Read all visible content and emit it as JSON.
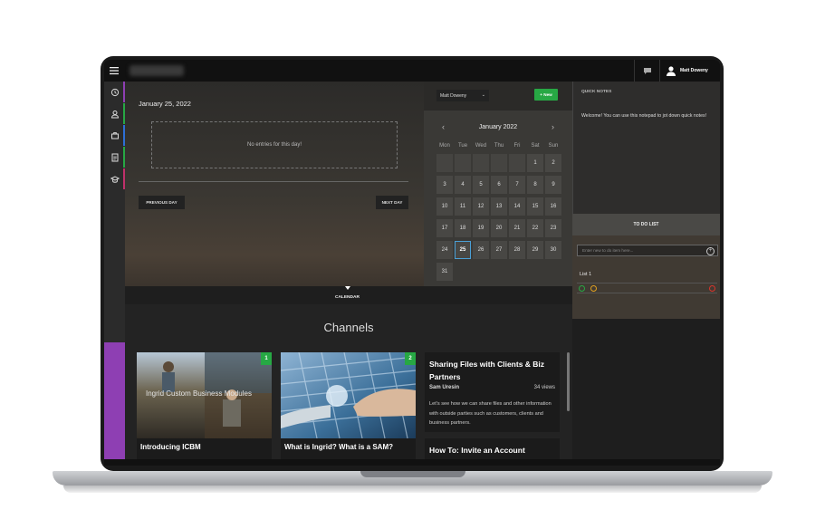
{
  "topbar": {
    "user_name": "Matt Doweny",
    "icons": [
      "hamburger-icon",
      "chat-icon",
      "user-avatar-icon"
    ]
  },
  "rail": {
    "items": [
      {
        "icon": "history-icon",
        "accent": "#8e3fb3"
      },
      {
        "icon": "user-card-icon",
        "accent": "#27a844"
      },
      {
        "icon": "briefcase-icon",
        "accent": "#2d6fd6"
      },
      {
        "icon": "document-icon",
        "accent": "#27a844"
      },
      {
        "icon": "graduation-cap-icon",
        "accent": "#c0306a"
      }
    ]
  },
  "day_panel": {
    "date": "January 25, 2022",
    "empty_message": "No entries for this day!",
    "prev_label": "PREVIOUS DAY",
    "next_label": "NEXT DAY",
    "strip_label": "CALENDAR"
  },
  "calendar": {
    "user_select": "Matt Doweny",
    "new_label": "+ New",
    "month": "January 2022",
    "weekdays": [
      "Mon",
      "Tue",
      "Wed",
      "Thu",
      "Fri",
      "Sat",
      "Sun"
    ],
    "weeks": [
      [
        "",
        "",
        "",
        "",
        "",
        "1",
        "2"
      ],
      [
        "3",
        "4",
        "5",
        "6",
        "7",
        "8",
        "9"
      ],
      [
        "10",
        "11",
        "12",
        "13",
        "14",
        "15",
        "16"
      ],
      [
        "17",
        "18",
        "19",
        "20",
        "21",
        "22",
        "23"
      ],
      [
        "24",
        "25",
        "26",
        "27",
        "28",
        "29",
        "30"
      ],
      [
        "31",
        "",
        "",
        "",
        "",
        "",
        ""
      ]
    ],
    "selected_day": "25"
  },
  "notes": {
    "title": "QUICK NOTES",
    "text": "Welcome! You can use this notepad to jot down quick notes!"
  },
  "todo": {
    "title": "TO DO LIST",
    "input_placeholder": "Enter new to do item here...",
    "list_name": "List 1"
  },
  "channels": {
    "title": "Channels",
    "cards": [
      {
        "badge": "1",
        "title": "Introducing ICBM",
        "overlay": "Ingrid Custom Business Modules"
      },
      {
        "badge": "2",
        "title": "What is Ingrid? What is a SAM?"
      }
    ],
    "articles": [
      {
        "title": "Sharing Files with Clients & Biz Partners",
        "author": "Sam Uresin",
        "views": "34 views",
        "desc": "Let's see how we can share files and other information with outside parties such as customers, clients and business partners."
      },
      {
        "title": "How To: Invite an Account"
      }
    ]
  },
  "colors": {
    "accent_green": "#27a844",
    "purple": "#8e3fb3",
    "today_border": "#4aa0d6"
  }
}
